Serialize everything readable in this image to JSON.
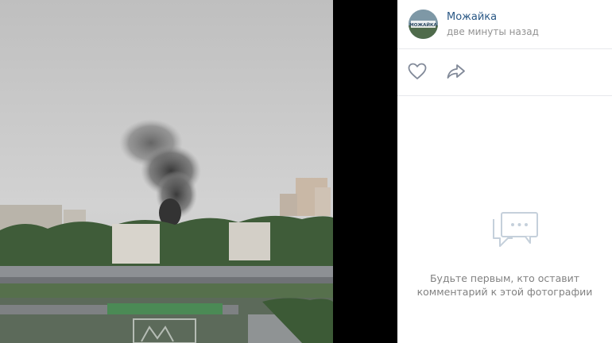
{
  "post": {
    "author": "Можайка",
    "time": "две минуты назад",
    "avatar_text": "МОЖАЙКА"
  },
  "actions": {
    "like_icon": "heart-icon",
    "share_icon": "share-arrow-icon"
  },
  "comments": {
    "empty_line1": "Будьте первым, кто оставит",
    "empty_line2": "комментарий к этой фотографии",
    "empty_icon": "comment-bubble-icon"
  },
  "colors": {
    "author_link": "#2a5885",
    "muted_text": "#828282",
    "icon_gray": "#828a99",
    "divider": "#e7e8ec"
  }
}
